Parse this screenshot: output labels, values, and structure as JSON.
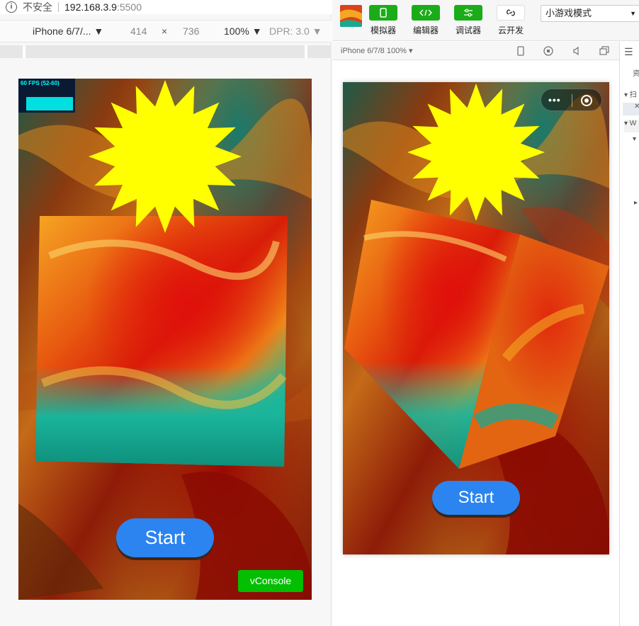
{
  "chrome": {
    "insecure_label": "不安全",
    "host": "192.168.3.9",
    "port": ":5500",
    "device": "iPhone 6/7/...",
    "width": "414",
    "times": "×",
    "height": "736",
    "zoom": "100%",
    "dpr": "DPR: 3.0"
  },
  "game_left": {
    "fps_text": "60 FPS (52-60)",
    "start_label": "Start",
    "vconsole_label": "vConsole"
  },
  "wechat": {
    "toolbar": [
      {
        "label": "模拟器",
        "icon": "phone-icon"
      },
      {
        "label": "编辑器",
        "icon": "code-icon"
      },
      {
        "label": "调试器",
        "icon": "sliders-icon"
      },
      {
        "label": "云开发",
        "icon": "link-icon"
      }
    ],
    "mode_label": "小游戏模式",
    "device_label": "iPhone 6/7/8 100% ▾",
    "panel_items": [
      "资",
      "▾ 扫",
      "✕",
      "▾ W",
      "▾",
      "▸"
    ],
    "start_label": "Start"
  },
  "colors": {
    "star": "#ffff00",
    "start_button": "#2b84f0",
    "vconsole": "#04be02",
    "toolbar_green": "#1aad19",
    "fps_text": "#00ffff"
  }
}
